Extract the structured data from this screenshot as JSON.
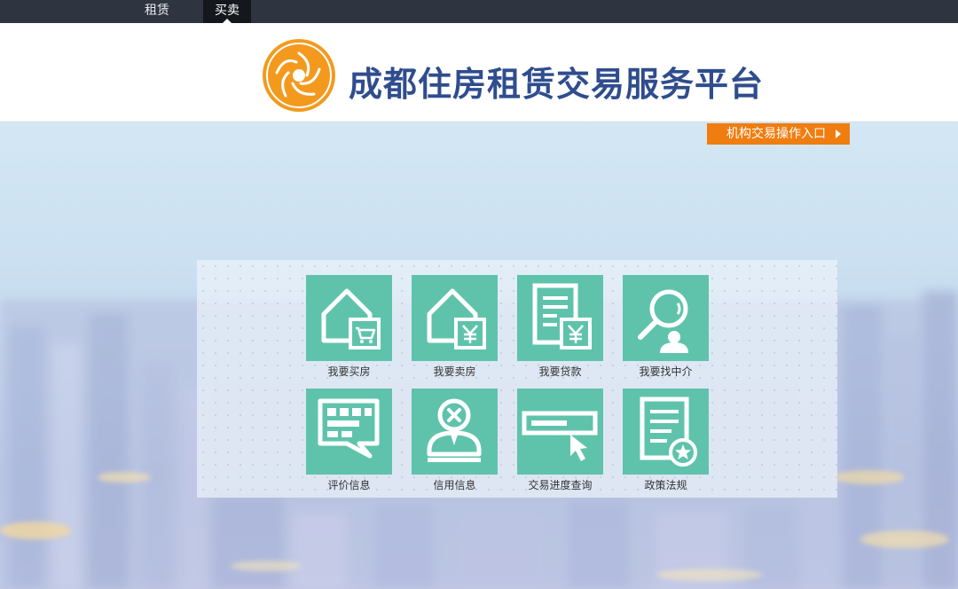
{
  "topbar": {
    "tabs": [
      {
        "label": "租赁"
      },
      {
        "label": "买卖"
      }
    ]
  },
  "header": {
    "title": "成都住房租赁交易服务平台"
  },
  "org_entrance": {
    "label": "机构交易操作入口"
  },
  "services": [
    {
      "label": "我要买房",
      "icon": "house-cart-icon"
    },
    {
      "label": "我要卖房",
      "icon": "house-yuan-icon"
    },
    {
      "label": "我要贷款",
      "icon": "document-yuan-icon"
    },
    {
      "label": "我要找中介",
      "icon": "agent-search-icon"
    },
    {
      "label": "评价信息",
      "icon": "comment-icon"
    },
    {
      "label": "信用信息",
      "icon": "credit-user-icon"
    },
    {
      "label": "交易进度查询",
      "icon": "progress-cursor-icon"
    },
    {
      "label": "政策法规",
      "icon": "policy-document-icon"
    }
  ],
  "colors": {
    "topbar": "#2f3540",
    "tile": "#5fc3ac",
    "title": "#2f4d8e",
    "org_button": "#f07d10"
  }
}
